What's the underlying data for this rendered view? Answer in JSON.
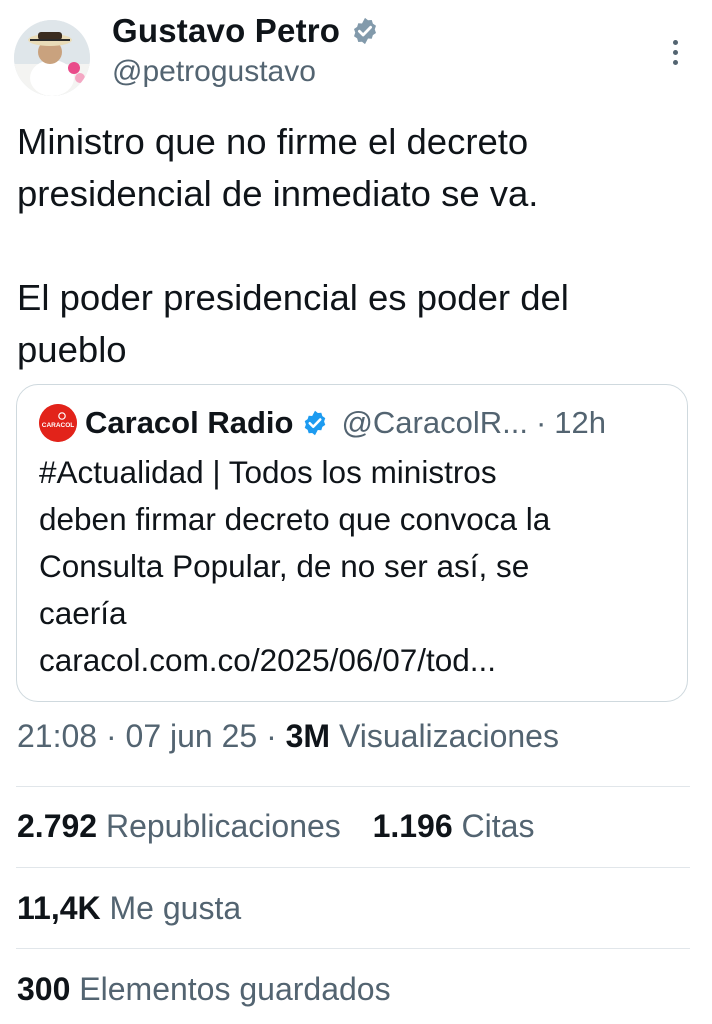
{
  "author": {
    "name": "Gustavo Petro",
    "handle": "@petrogustavo",
    "verified_color": "#829aab"
  },
  "tweet": {
    "paragraphs": [
      "Ministro que no firme el decreto presidencial de inmediato se va.",
      "El poder presidencial es poder del pueblo"
    ]
  },
  "quote": {
    "avatar_text": "CARACOL",
    "name": "Caracol Radio",
    "handle": "@CaracolR...",
    "separator": "·",
    "time": "12h",
    "verified_color": "#1d9bf0",
    "brand_color": "#e2231a",
    "lines": [
      "#Actualidad | Todos los ministros",
      "deben firmar decreto que convoca la",
      "Consulta Popular, de no ser así, se",
      "caería",
      "caracol.com.co/2025/06/07/tod..."
    ]
  },
  "meta": {
    "time": "21:08",
    "sep1": "·",
    "date": "07 jun 25",
    "sep2": "·",
    "views_count": "3M",
    "views_label": "Visualizaciones"
  },
  "stats": {
    "reposts_count": "2.792",
    "reposts_label": "Republicaciones",
    "quotes_count": "1.196",
    "quotes_label": "Citas",
    "likes_count": "11,4K",
    "likes_label": "Me gusta",
    "bookmarks_count": "300",
    "bookmarks_label": "Elementos guardados"
  },
  "icons": {
    "more": "more-vertical-icon",
    "verified": "verified-badge-icon"
  }
}
